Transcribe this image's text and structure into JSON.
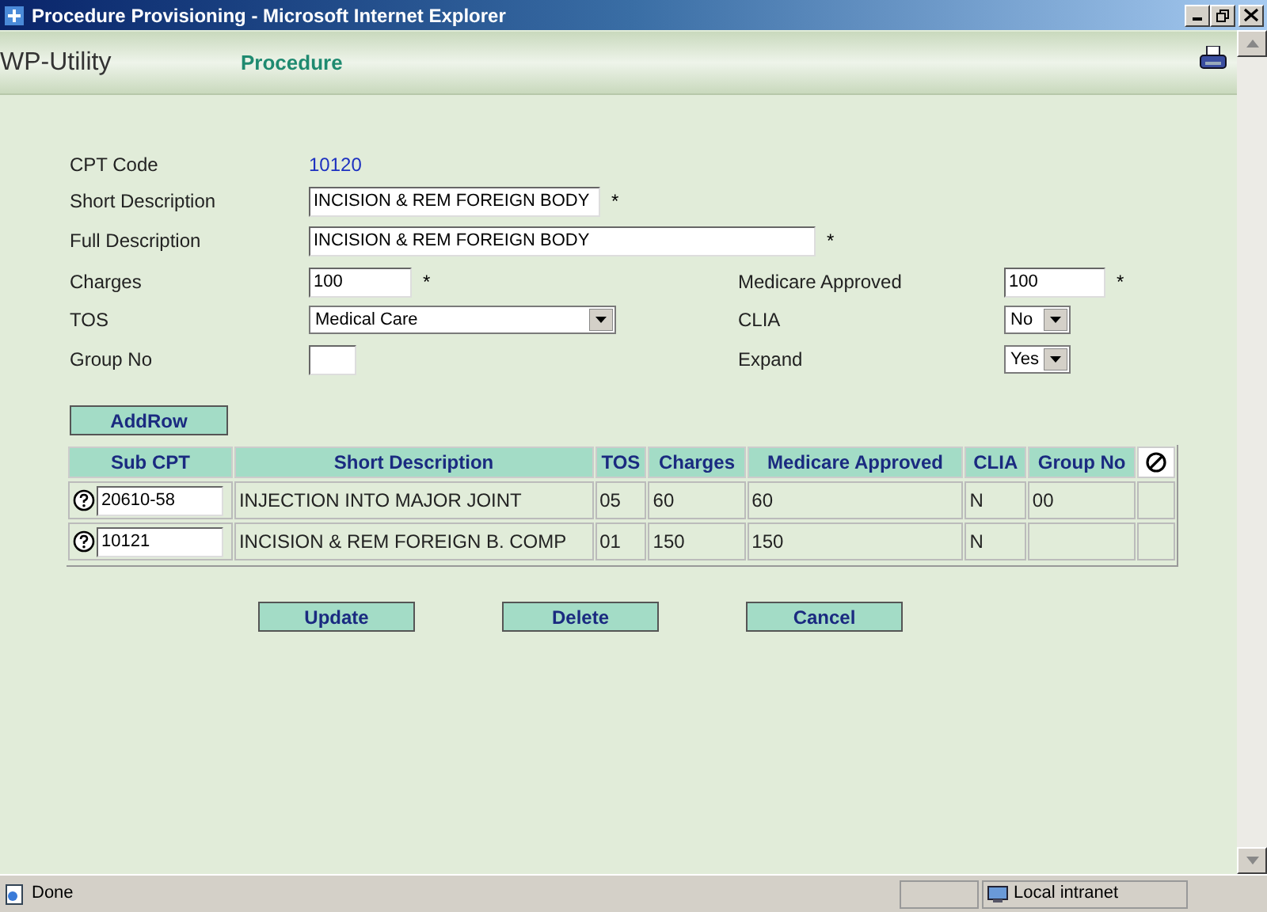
{
  "window": {
    "title": "Procedure Provisioning - Microsoft Internet Explorer"
  },
  "header": {
    "app_name": "WP-Utility",
    "page_title": "Procedure"
  },
  "form": {
    "cpt_code": {
      "label": "CPT Code",
      "value": "10120"
    },
    "short_description": {
      "label": "Short Description",
      "value": "INCISION & REM FOREIGN BODY",
      "required": "*"
    },
    "full_description": {
      "label": "Full Description",
      "value": "INCISION & REM FOREIGN BODY",
      "required": "*"
    },
    "charges": {
      "label": "Charges",
      "value": "100",
      "required": "*"
    },
    "medicare_approved": {
      "label": "Medicare Approved",
      "value": "100",
      "required": "*"
    },
    "tos": {
      "label": "TOS",
      "value": "Medical Care"
    },
    "clia": {
      "label": "CLIA",
      "value": "No"
    },
    "group_no": {
      "label": "Group No"
    },
    "expand": {
      "label": "Expand",
      "value": "Yes"
    }
  },
  "add_row_button": "AddRow",
  "table": {
    "columns": [
      "Sub CPT",
      "Short Description",
      "TOS",
      "Charges",
      "Medicare Approved",
      "CLIA",
      "Group No"
    ],
    "rows": [
      {
        "cells": [
          "20610-58",
          "INJECTION INTO MAJOR JOINT",
          "05",
          "60",
          "60",
          "N",
          "00"
        ]
      },
      {
        "cells": [
          "10121",
          "INCISION & REM FOREIGN B. COMP",
          "01",
          "150",
          "150",
          "N",
          ""
        ]
      }
    ]
  },
  "buttons": [
    "Update",
    "Delete",
    "Cancel"
  ],
  "status_bar": {
    "status": "Done",
    "zone": "Local intranet"
  }
}
